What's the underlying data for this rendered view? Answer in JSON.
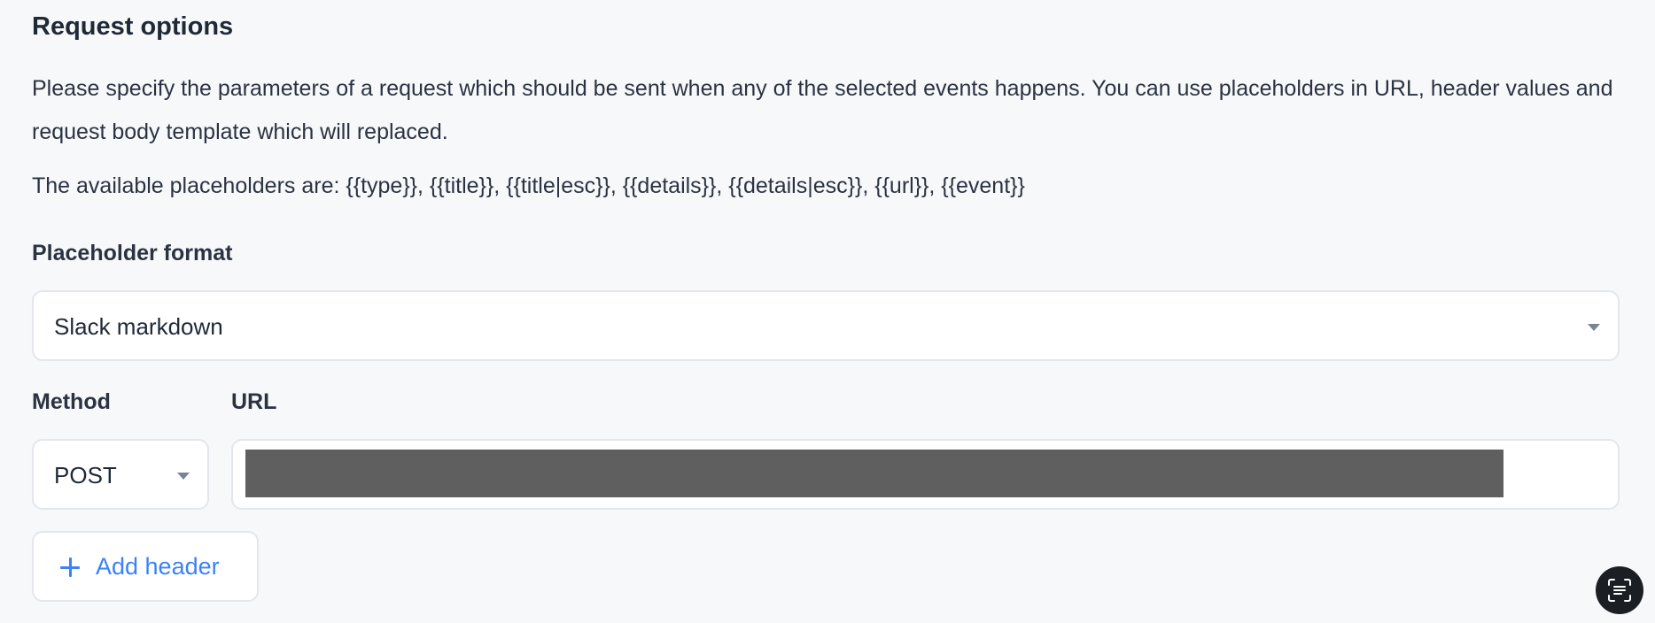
{
  "section": {
    "title": "Request options",
    "description": "Please specify the parameters of a request which should be sent when any of the selected events happens. You can use placeholders in URL, header values and request body template which will replaced.",
    "placeholders_text": "The available placeholders are: {{type}}, {{title}}, {{title|esc}}, {{details}}, {{details|esc}}, {{url}}, {{event}}"
  },
  "placeholder_format": {
    "label": "Placeholder format",
    "selected": "Slack markdown"
  },
  "method": {
    "label": "Method",
    "selected": "POST"
  },
  "url": {
    "label": "URL"
  },
  "add_header": {
    "label": "Add header",
    "icon": "plus-icon"
  },
  "scan_button": {
    "icon": "text-scan-icon"
  },
  "colors": {
    "accent": "#3b82f6",
    "background": "#f7f8fa",
    "border": "#e3e6eb",
    "redaction": "#5f5f5f"
  }
}
